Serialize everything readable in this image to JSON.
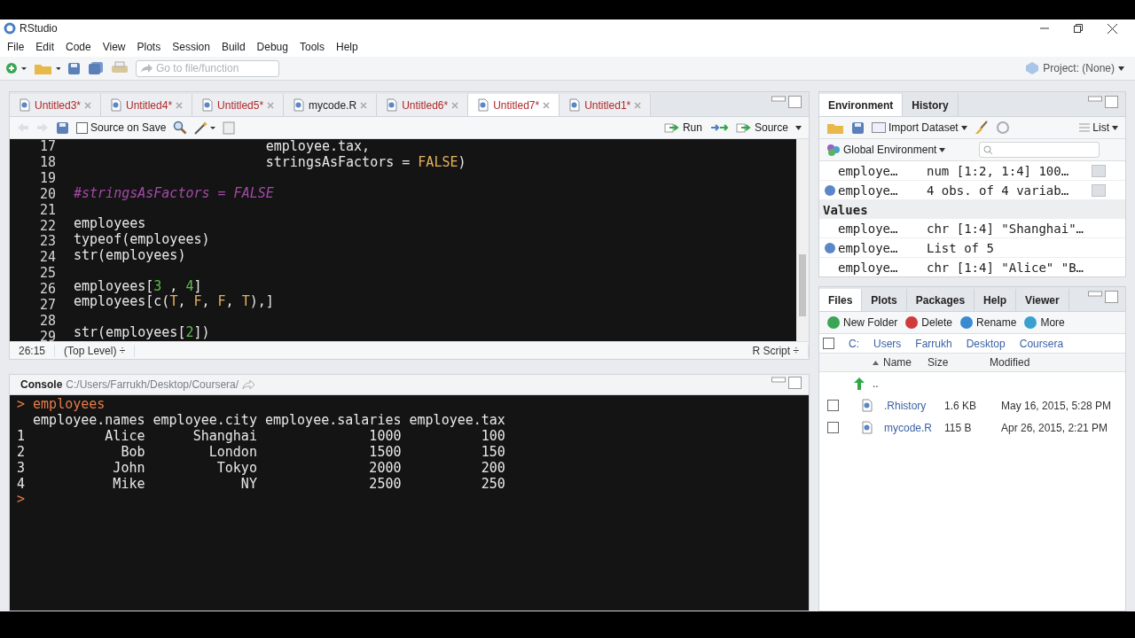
{
  "window": {
    "title": "RStudio"
  },
  "menu": [
    "File",
    "Edit",
    "Code",
    "View",
    "Plots",
    "Session",
    "Build",
    "Debug",
    "Tools",
    "Help"
  ],
  "toolbar": {
    "goto_placeholder": "Go to file/function",
    "project": "Project: (None)"
  },
  "source": {
    "tabs": [
      {
        "label": "Untitled3*",
        "unsaved": true,
        "selected": false
      },
      {
        "label": "Untitled4*",
        "unsaved": true,
        "selected": false
      },
      {
        "label": "Untitled5*",
        "unsaved": true,
        "selected": false
      },
      {
        "label": "mycode.R",
        "unsaved": false,
        "selected": false
      },
      {
        "label": "Untitled6*",
        "unsaved": true,
        "selected": false
      },
      {
        "label": "Untitled7*",
        "unsaved": true,
        "selected": true
      },
      {
        "label": "Untitled1*",
        "unsaved": true,
        "selected": false
      }
    ],
    "source_on_save": {
      "label": "Source on Save",
      "checked": false
    },
    "run": "Run",
    "source_button": "Source",
    "lines": [
      {
        "number": "17",
        "tokens": [
          {
            "text": "                        employee.tax,",
            "kind": "plain"
          }
        ]
      },
      {
        "number": "18",
        "tokens": [
          {
            "text": "                        stringsAsFactors = ",
            "kind": "plain"
          },
          {
            "text": "FALSE",
            "kind": "constant"
          },
          {
            "text": ")",
            "kind": "plain"
          }
        ]
      },
      {
        "number": "19"
      },
      {
        "number": "20",
        "tokens": [
          {
            "text": "#stringsAsFactors = FALSE",
            "kind": "comment"
          }
        ]
      },
      {
        "number": "21"
      },
      {
        "number": "22",
        "tokens": [
          {
            "text": "employees",
            "kind": "plain"
          }
        ]
      },
      {
        "number": "23",
        "tokens": [
          {
            "text": "typeof(employees)",
            "kind": "plain"
          }
        ]
      },
      {
        "number": "24",
        "tokens": [
          {
            "text": "str(employees)",
            "kind": "plain"
          }
        ]
      },
      {
        "number": "25"
      },
      {
        "number": "26",
        "tokens": [
          {
            "text": "employees[",
            "kind": "plain"
          },
          {
            "text": "3",
            "kind": "number"
          },
          {
            "text": " , ",
            "kind": "plain"
          },
          {
            "text": "4",
            "kind": "number"
          },
          {
            "text": "]",
            "kind": "plain"
          }
        ]
      },
      {
        "number": "27",
        "tokens": [
          {
            "text": "employees[c(",
            "kind": "plain"
          },
          {
            "text": "T",
            "kind": "constant"
          },
          {
            "text": ", ",
            "kind": "plain"
          },
          {
            "text": "F",
            "kind": "constant"
          },
          {
            "text": ", ",
            "kind": "plain"
          },
          {
            "text": "F",
            "kind": "constant"
          },
          {
            "text": ", ",
            "kind": "plain"
          },
          {
            "text": "T",
            "kind": "constant"
          },
          {
            "text": "),]",
            "kind": "plain"
          }
        ]
      },
      {
        "number": "28"
      },
      {
        "number": "29",
        "tokens": [
          {
            "text": "str(employees[",
            "kind": "plain"
          },
          {
            "text": "2",
            "kind": "number"
          },
          {
            "text": "])",
            "kind": "plain"
          }
        ]
      }
    ],
    "status": {
      "position": "26:15",
      "scope": "(Top Level) ÷",
      "type": "R Script ÷"
    }
  },
  "console": {
    "title": "Console",
    "path": "C:/Users/Farrukh/Desktop/Coursera/",
    "lines": [
      {
        "kind": "input",
        "text": "> employees"
      },
      {
        "kind": "output",
        "text": "  employee.names employee.city employee.salaries employee.tax"
      },
      {
        "kind": "output",
        "text": "1          Alice      Shanghai              1000          100"
      },
      {
        "kind": "output",
        "text": "2            Bob        London              1500          150"
      },
      {
        "kind": "output",
        "text": "3           John         Tokyo              2000          200"
      },
      {
        "kind": "output",
        "text": "4           Mike            NY              2500          250"
      },
      {
        "kind": "prompt",
        "text": ">"
      }
    ]
  },
  "environment": {
    "tabs": [
      {
        "label": "Environment",
        "selected": true
      },
      {
        "label": "History",
        "selected": false
      }
    ],
    "import": "Import Dataset",
    "view": "List",
    "scope": "Global Environment",
    "rows": [
      {
        "kind": "item",
        "name": "employe…",
        "value": "num [1:2, 1:4] 100…",
        "expandable": false,
        "grid": true
      },
      {
        "kind": "item",
        "name": "employe…",
        "value": "4 obs. of 4 variab…",
        "expandable": true,
        "grid": true
      },
      {
        "kind": "section",
        "name": "Values"
      },
      {
        "kind": "item",
        "name": "employe…",
        "value": "chr [1:4] \"Shanghai\"…",
        "expandable": false,
        "grid": false
      },
      {
        "kind": "item",
        "name": "employe…",
        "value": "List of 5",
        "expandable": true,
        "grid": false
      },
      {
        "kind": "item",
        "name": "employe…",
        "value": "chr [1:4] \"Alice\" \"B…",
        "expandable": false,
        "grid": false
      }
    ]
  },
  "files": {
    "tabs": [
      {
        "label": "Files",
        "selected": true
      },
      {
        "label": "Plots",
        "selected": false
      },
      {
        "label": "Packages",
        "selected": false
      },
      {
        "label": "Help",
        "selected": false
      },
      {
        "label": "Viewer",
        "selected": false
      }
    ],
    "actions": [
      "New Folder",
      "Delete",
      "Rename",
      "More"
    ],
    "select_all_checked": false,
    "breadcrumbs": [
      "C:",
      "Users",
      "Farrukh",
      "Desktop",
      "Coursera"
    ],
    "columns": [
      "Name",
      "Size",
      "Modified"
    ],
    "up": "..",
    "rows": [
      {
        "name": ".Rhistory",
        "size": "1.6 KB",
        "modified": "May 16, 2015, 5:28 PM",
        "checked": false
      },
      {
        "name": "mycode.R",
        "size": "115 B",
        "modified": "Apr 26, 2015, 2:21 PM",
        "checked": false
      }
    ]
  }
}
